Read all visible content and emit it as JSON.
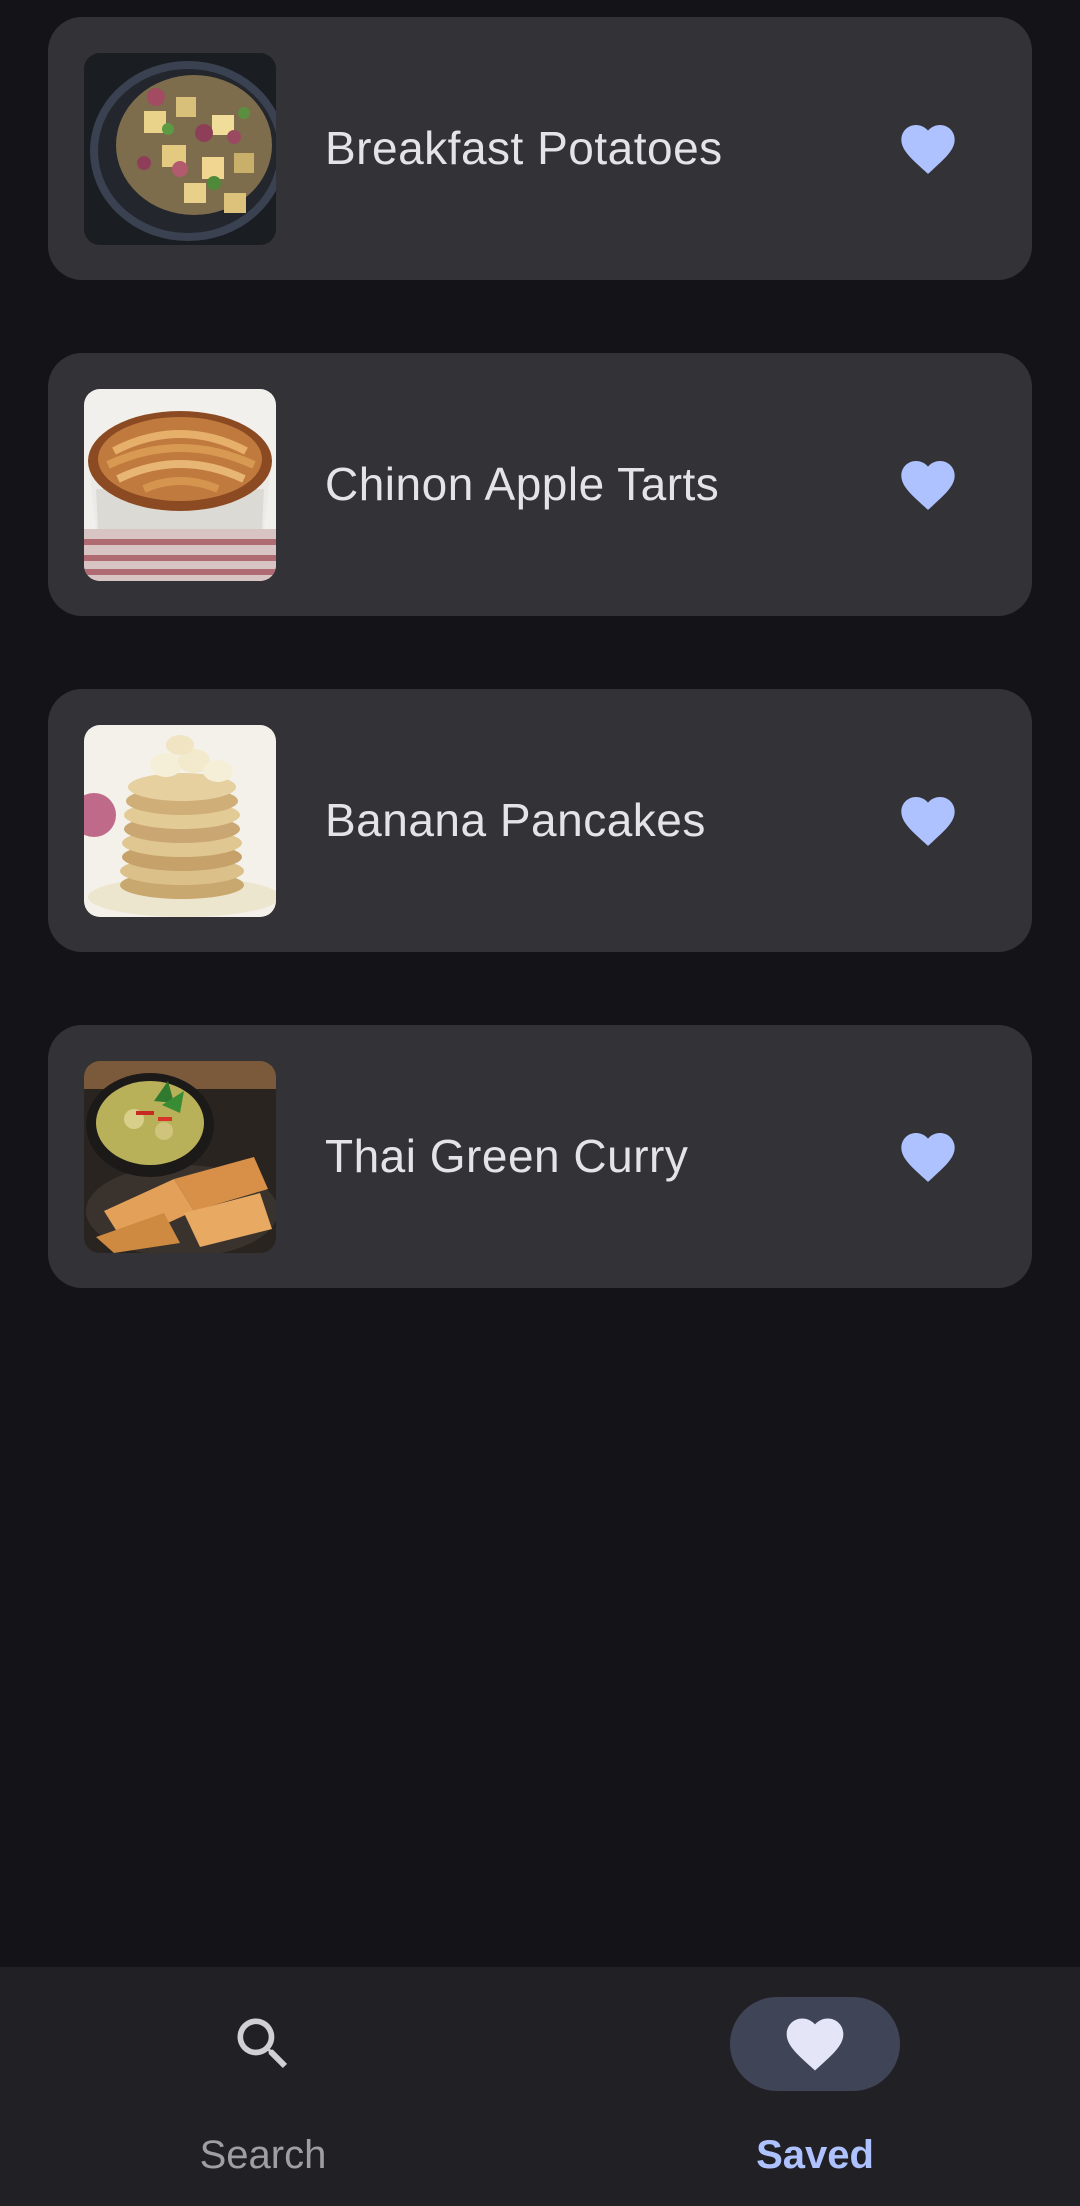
{
  "colors": {
    "background": "#141418",
    "card": "#323237",
    "accent": "#aec2ff",
    "nav_background": "#212125",
    "nav_active_pill": "#3f4457"
  },
  "recipes": [
    {
      "title": "Breakfast Potatoes",
      "favorite_icon": "heart-icon"
    },
    {
      "title": "Chinon Apple Tarts",
      "favorite_icon": "heart-icon"
    },
    {
      "title": "Banana Pancakes",
      "favorite_icon": "heart-icon"
    },
    {
      "title": "Thai Green Curry",
      "favorite_icon": "heart-icon"
    }
  ],
  "bottom_nav": {
    "search": {
      "label": "Search",
      "icon": "search-icon"
    },
    "saved": {
      "label": "Saved",
      "icon": "heart-icon",
      "active": true
    }
  }
}
